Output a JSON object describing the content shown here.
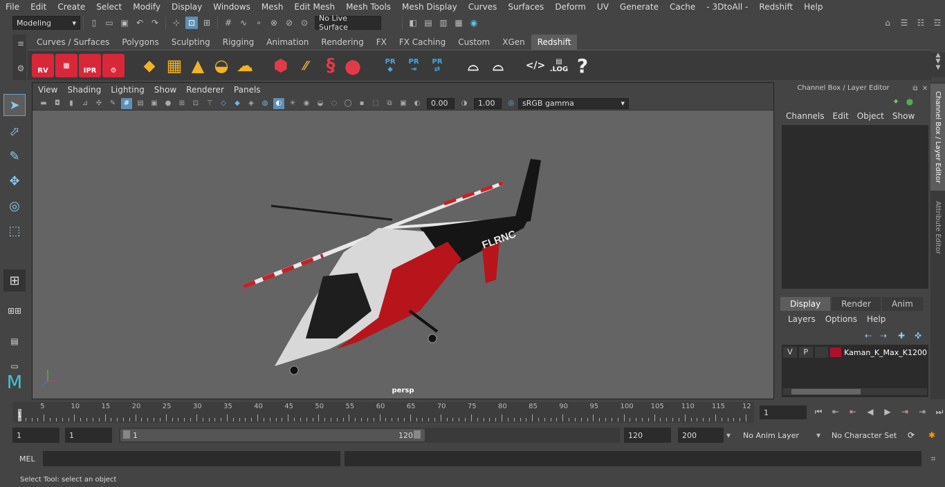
{
  "menubar": [
    "File",
    "Edit",
    "Create",
    "Select",
    "Modify",
    "Display",
    "Windows",
    "Mesh",
    "Edit Mesh",
    "Mesh Tools",
    "Mesh Display",
    "Curves",
    "Surfaces",
    "Deform",
    "UV",
    "Generate",
    "Cache",
    "- 3DtoAll -",
    "Redshift",
    "Help"
  ],
  "status": {
    "mode": "Modeling",
    "live_surface": "No Live Surface"
  },
  "shelf_tabs": [
    "Curves / Surfaces",
    "Polygons",
    "Sculpting",
    "Rigging",
    "Animation",
    "Rendering",
    "FX",
    "FX Caching",
    "Custom",
    "XGen",
    "Redshift"
  ],
  "shelf_icons": {
    "rv": "RV",
    "ipr": "IPR",
    "pr": "PR",
    "log": ".LOG",
    "help": "?"
  },
  "panel_menu": [
    "View",
    "Shading",
    "Lighting",
    "Show",
    "Renderer",
    "Panels"
  ],
  "panel_toolbar": {
    "exposure": "0.00",
    "gamma": "1.00",
    "colorspace": "sRGB gamma"
  },
  "viewport": {
    "camera": "persp"
  },
  "model": {
    "tail_text": "FLRNC"
  },
  "channel_box": {
    "title": "Channel Box / Layer Editor",
    "menu": [
      "Channels",
      "Edit",
      "Object",
      "Show"
    ]
  },
  "layer_editor": {
    "tabs": [
      "Display",
      "Render",
      "Anim"
    ],
    "menu": [
      "Layers",
      "Options",
      "Help"
    ],
    "layer": {
      "v": "V",
      "p": "P",
      "name": "Kaman_K_Max_K1200",
      "color": "#b0102c"
    }
  },
  "side_tabs": [
    "Channel Box / Layer Editor",
    "Attribute Editor"
  ],
  "timeline": {
    "ticks": [
      "5",
      "10",
      "15",
      "20",
      "25",
      "30",
      "35",
      "40",
      "45",
      "50",
      "55",
      "60",
      "65",
      "70",
      "75",
      "80",
      "85",
      "90",
      "95",
      "100",
      "105",
      "110",
      "115",
      "12"
    ],
    "current": "1",
    "current_frame_field": "1"
  },
  "range": {
    "start": "1",
    "start2": "1",
    "slider_start": "1",
    "slider_end": "120",
    "end": "120",
    "end2": "200",
    "anim_layer": "No Anim Layer",
    "character_set": "No Character Set"
  },
  "cmd": {
    "label": "MEL"
  },
  "help_line": "Select Tool: select an object"
}
